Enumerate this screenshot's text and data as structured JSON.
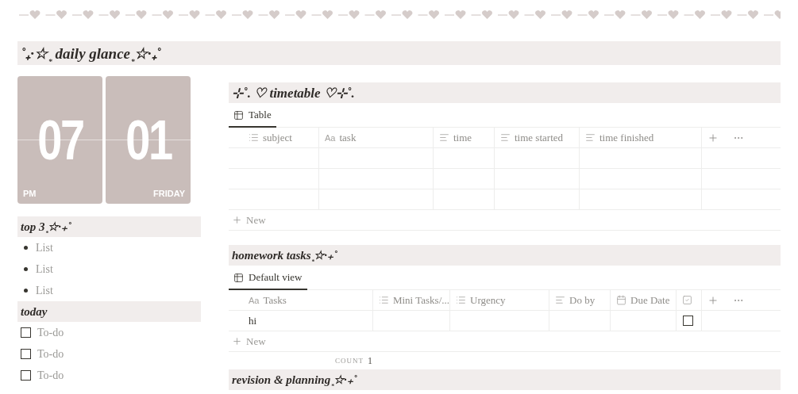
{
  "page_title": "˚₊·☆ ͙ daily glance ͙☆·₊˚",
  "clock": {
    "hour": "07",
    "minute": "01",
    "period": "PM",
    "day": "FRIDAY"
  },
  "top3": {
    "title": "top 3 ͙☆·₊˚",
    "items": [
      "List",
      "List",
      "List"
    ]
  },
  "today": {
    "title": "today",
    "todos": [
      {
        "label": "To-do",
        "checked": false
      },
      {
        "label": "To-do",
        "checked": false
      },
      {
        "label": "To-do",
        "checked": false
      }
    ]
  },
  "timetable": {
    "title": "⊹˚. ♡ timetable ♡⊹˚.",
    "views": [
      {
        "label": "Table",
        "selected": true
      }
    ],
    "columns": [
      {
        "label": "subject",
        "kind": "list"
      },
      {
        "label": "task",
        "kind": "title",
        "glyph": "Aa"
      },
      {
        "label": "time",
        "kind": "text"
      },
      {
        "label": "time started",
        "kind": "text"
      },
      {
        "label": "time finished",
        "kind": "text"
      }
    ],
    "rows": [
      {
        "kind": "empty"
      },
      {
        "kind": "empty"
      },
      {
        "kind": "empty"
      }
    ],
    "new_label": "New"
  },
  "homework": {
    "title": "homework tasks ͙☆·₊˚",
    "views": [
      {
        "label": "Default view",
        "selected": true
      }
    ],
    "columns": [
      {
        "label": "Tasks",
        "kind": "title",
        "glyph": "Aa"
      },
      {
        "label": "Mini Tasks/...",
        "kind": "list"
      },
      {
        "label": "Urgency",
        "kind": "list"
      },
      {
        "label": "Do by",
        "kind": "text"
      },
      {
        "label": "Due Date",
        "kind": "date"
      },
      {
        "kind": "checkbox"
      }
    ],
    "rows": [
      {
        "kind": "task",
        "title": "hi",
        "done": false
      }
    ],
    "new_label": "New",
    "count": {
      "label": "COUNT",
      "value": "1"
    }
  },
  "revision": {
    "title": "revision & planning ͙☆·₊˚"
  }
}
